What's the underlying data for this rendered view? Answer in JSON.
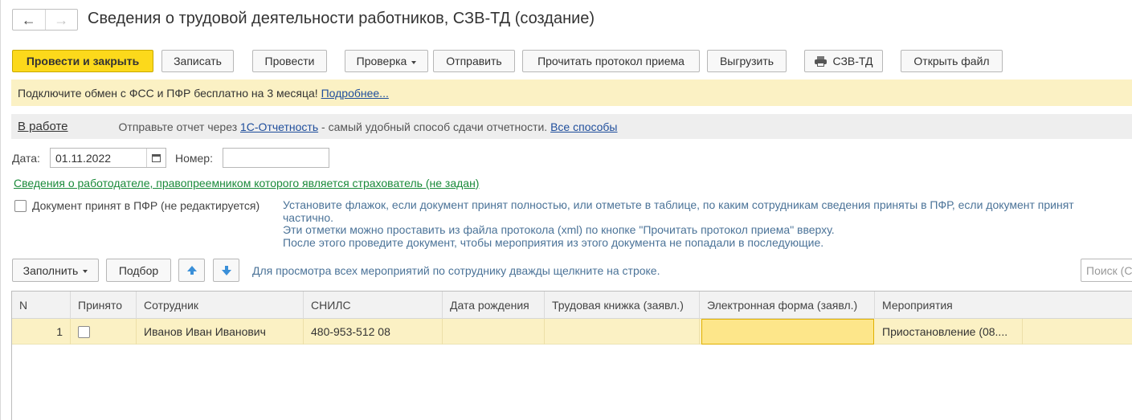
{
  "window": {
    "title": "Сведения о трудовой деятельности работников, СЗВ-ТД (создание)",
    "back_icon": "←",
    "forward_icon": "→"
  },
  "toolbar": {
    "post_close": "Провести и закрыть",
    "save": "Записать",
    "post": "Провести",
    "check": "Проверка",
    "send": "Отправить",
    "read_protocol": "Прочитать протокол приема",
    "export": "Выгрузить",
    "print_szv": "СЗВ-ТД",
    "open_file": "Открыть файл"
  },
  "banner": {
    "text": "Подключите обмен с ФСС и ПФР бесплатно на 3 месяца!",
    "link": "Подробнее..."
  },
  "status": {
    "state": "В работе",
    "text_before": "Отправьте отчет через ",
    "link1": "1С-Отчетность",
    "text_after": " - самый удобный способ сдачи отчетности. ",
    "link2": "Все способы"
  },
  "form": {
    "date_label": "Дата:",
    "date_value": "01.11.2022",
    "number_label": "Номер:",
    "number_value": "",
    "employer_link": "Сведения о работодателе, правопреемником которого является страхователь (не задан)",
    "accepted_label": "Документ принят в ПФР (не редактируется)",
    "hint_lines": [
      "Установите флажок, если документ принят полностью, или отметьте в таблице, по каким сотрудникам сведения приняты в ПФР, если документ принят",
      "частично.",
      "Эти отметки можно проставить из файла протокола (xml) по кнопке \"Прочитать протокол приема\" вверху.",
      "После этого проведите документ, чтобы мероприятия из этого документа не попадали в последующие."
    ]
  },
  "table_toolbar": {
    "fill": "Заполнить",
    "select": "Подбор",
    "hint": "Для просмотра всех мероприятий по сотруднику дважды щелкните на строке.",
    "search_placeholder": "Поиск (Ctrl+F)"
  },
  "table": {
    "columns": [
      "N",
      "Принято",
      "Сотрудник",
      "СНИЛС",
      "Дата рождения",
      "Трудовая книжка (заявл.)",
      "Электронная форма (заявл.)",
      "Мероприятия"
    ],
    "rows": [
      {
        "n": "1",
        "accepted": false,
        "employee": "Иванов Иван Иванович",
        "snils": "480-953-512 08",
        "birth_date": "",
        "work_book": "",
        "electronic_form": "",
        "events": "Приостановление (08...."
      }
    ]
  },
  "colors": {
    "accent_yellow": "#fcd91b",
    "banner_bg": "#fbf1c4",
    "link_blue": "#1f4e9c",
    "hint_blue": "#4b7398",
    "link_green": "#1a8a3a"
  }
}
